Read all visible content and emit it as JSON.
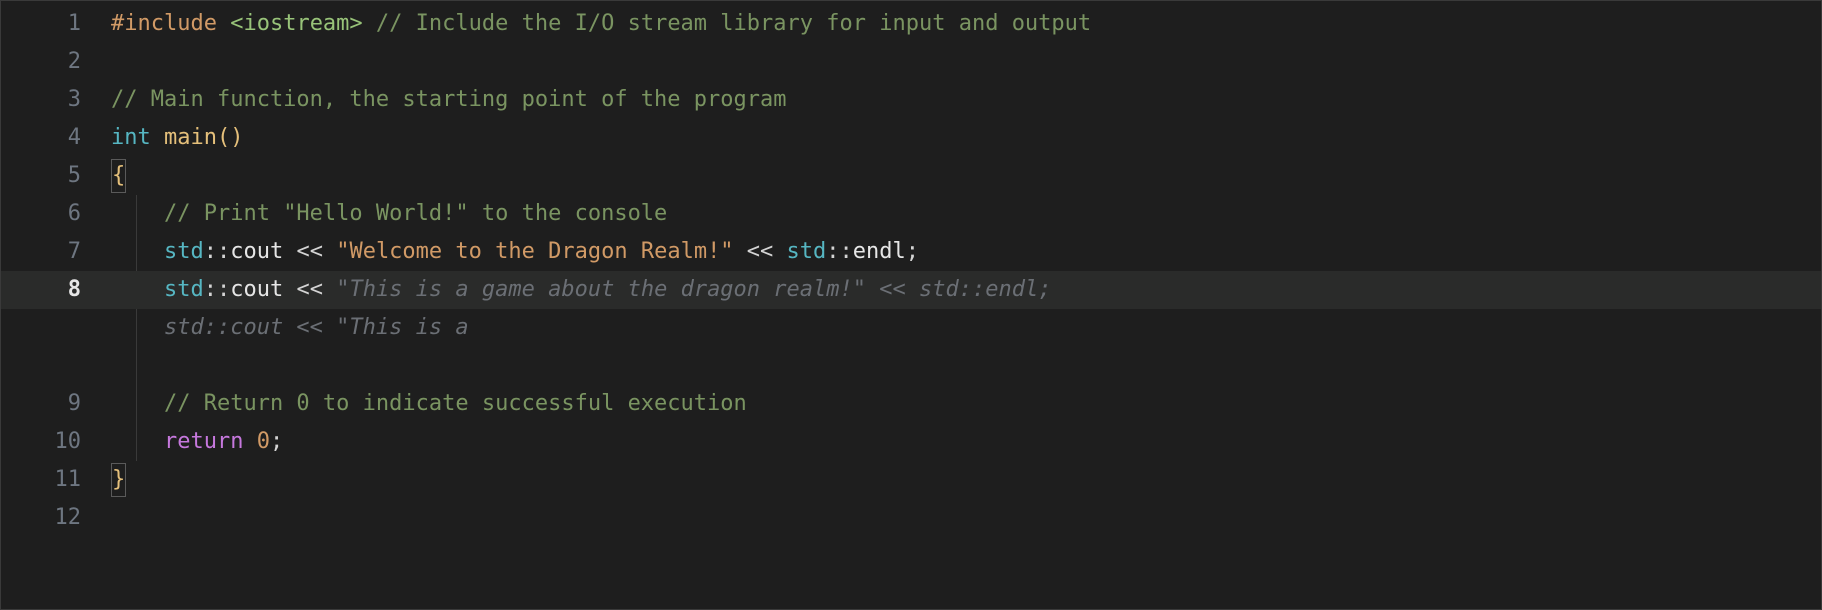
{
  "gutter": {
    "lines": [
      "1",
      "2",
      "3",
      "4",
      "5",
      "6",
      "7",
      "8",
      "9",
      "10",
      "11",
      "12"
    ],
    "active": "8"
  },
  "code": {
    "l1": {
      "directive": "#include",
      "target": "<iostream>",
      "comment": "// Include the I/O stream library for input and output"
    },
    "l3": {
      "comment": "// Main function, the starting point of the program"
    },
    "l4": {
      "type": "int",
      "func": "main",
      "parens": "()"
    },
    "l5": {
      "brace": "{"
    },
    "l6": {
      "comment": "// Print \"Hello World!\" to the console"
    },
    "l7": {
      "ns1": "std",
      "scope1": "::",
      "ident1": "cout",
      "op1": " << ",
      "str": "\"Welcome to the Dragon Realm!\"",
      "op2": " << ",
      "ns2": "std",
      "scope2": "::",
      "ident2": "endl",
      "semi": ";"
    },
    "l8": {
      "ns": "std",
      "scope": "::",
      "ident": "cout",
      "op": " << ",
      "ghost": "\"This is a game about the dragon realm!\" << std::endl;",
      "ghost_wrap": "std::cout << \"This is a"
    },
    "l10": {
      "comment": "// Return 0 to indicate successful execution"
    },
    "l11": {
      "kw": "return",
      "num": "0",
      "semi": ";"
    },
    "l12": {
      "brace": "}"
    }
  }
}
